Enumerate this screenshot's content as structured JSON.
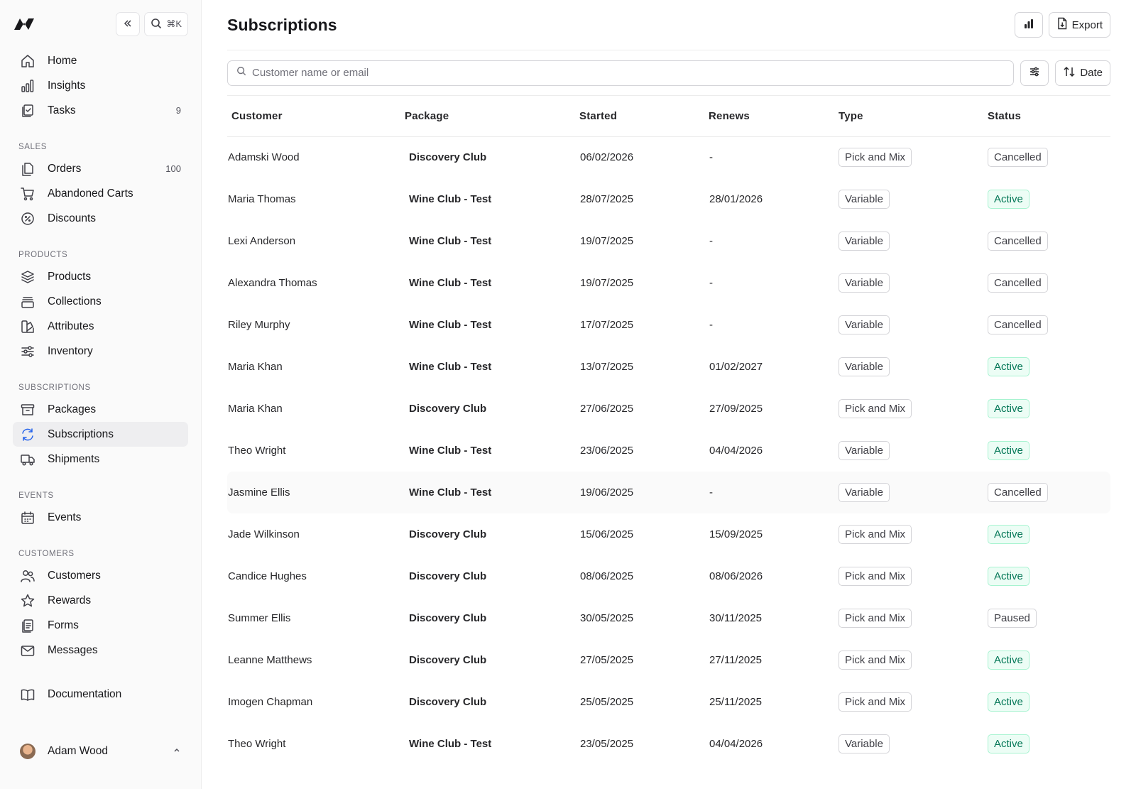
{
  "sidebar": {
    "search_shortcut": "⌘K",
    "main_items": [
      {
        "label": "Home",
        "icon": "home-icon",
        "count": ""
      },
      {
        "label": "Insights",
        "icon": "bar-chart-icon",
        "count": ""
      },
      {
        "label": "Tasks",
        "icon": "clipboard-check-icon",
        "count": "9"
      }
    ],
    "sections": [
      {
        "title": "SALES",
        "items": [
          {
            "label": "Orders",
            "icon": "documents-icon",
            "count": "100"
          },
          {
            "label": "Abandoned Carts",
            "icon": "cart-icon",
            "count": ""
          },
          {
            "label": "Discounts",
            "icon": "discount-icon",
            "count": ""
          }
        ]
      },
      {
        "title": "PRODUCTS",
        "items": [
          {
            "label": "Products",
            "icon": "layers-icon",
            "count": ""
          },
          {
            "label": "Collections",
            "icon": "collection-icon",
            "count": ""
          },
          {
            "label": "Attributes",
            "icon": "attributes-icon",
            "count": ""
          },
          {
            "label": "Inventory",
            "icon": "sliders-icon",
            "count": ""
          }
        ]
      },
      {
        "title": "SUBSCRIPTIONS",
        "items": [
          {
            "label": "Packages",
            "icon": "archive-box-icon",
            "count": ""
          },
          {
            "label": "Subscriptions",
            "icon": "refresh-icon",
            "count": "",
            "active": true
          },
          {
            "label": "Shipments",
            "icon": "truck-icon",
            "count": ""
          }
        ]
      },
      {
        "title": "EVENTS",
        "items": [
          {
            "label": "Events",
            "icon": "calendar-icon",
            "count": ""
          }
        ]
      },
      {
        "title": "CUSTOMERS",
        "items": [
          {
            "label": "Customers",
            "icon": "users-icon",
            "count": ""
          },
          {
            "label": "Rewards",
            "icon": "star-icon",
            "count": ""
          },
          {
            "label": "Forms",
            "icon": "forms-icon",
            "count": ""
          },
          {
            "label": "Messages",
            "icon": "envelope-icon",
            "count": ""
          }
        ]
      }
    ],
    "documentation": "Documentation",
    "user_name": "Adam Wood"
  },
  "header": {
    "title": "Subscriptions",
    "export_label": "Export"
  },
  "toolbar": {
    "search_placeholder": "Customer name or email",
    "sort_label": "Date"
  },
  "table": {
    "columns": [
      "Customer",
      "Package",
      "Started",
      "Renews",
      "Type",
      "Status"
    ],
    "rows": [
      {
        "customer": "Adamski Wood",
        "package": "Discovery Club",
        "started": "06/02/2026",
        "renews": "-",
        "type": "Pick and Mix",
        "status": "Cancelled"
      },
      {
        "customer": "Maria Thomas",
        "package": "Wine Club - Test",
        "started": "28/07/2025",
        "renews": "28/01/2026",
        "type": "Variable",
        "status": "Active"
      },
      {
        "customer": "Lexi Anderson",
        "package": "Wine Club - Test",
        "started": "19/07/2025",
        "renews": "-",
        "type": "Variable",
        "status": "Cancelled"
      },
      {
        "customer": "Alexandra Thomas",
        "package": "Wine Club - Test",
        "started": "19/07/2025",
        "renews": "-",
        "type": "Variable",
        "status": "Cancelled"
      },
      {
        "customer": "Riley Murphy",
        "package": "Wine Club - Test",
        "started": "17/07/2025",
        "renews": "-",
        "type": "Variable",
        "status": "Cancelled"
      },
      {
        "customer": "Maria Khan",
        "package": "Wine Club - Test",
        "started": "13/07/2025",
        "renews": "01/02/2027",
        "type": "Variable",
        "status": "Active"
      },
      {
        "customer": "Maria Khan",
        "package": "Discovery Club",
        "started": "27/06/2025",
        "renews": "27/09/2025",
        "type": "Pick and Mix",
        "status": "Active"
      },
      {
        "customer": "Theo Wright",
        "package": "Wine Club - Test",
        "started": "23/06/2025",
        "renews": "04/04/2026",
        "type": "Variable",
        "status": "Active"
      },
      {
        "customer": "Jasmine Ellis",
        "package": "Wine Club - Test",
        "started": "19/06/2025",
        "renews": "-",
        "type": "Variable",
        "status": "Cancelled",
        "highlighted": true
      },
      {
        "customer": "Jade Wilkinson",
        "package": "Discovery Club",
        "started": "15/06/2025",
        "renews": "15/09/2025",
        "type": "Pick and Mix",
        "status": "Active"
      },
      {
        "customer": "Candice Hughes",
        "package": "Discovery Club",
        "started": "08/06/2025",
        "renews": "08/06/2026",
        "type": "Pick and Mix",
        "status": "Active"
      },
      {
        "customer": "Summer Ellis",
        "package": "Discovery Club",
        "started": "30/05/2025",
        "renews": "30/11/2025",
        "type": "Pick and Mix",
        "status": "Paused"
      },
      {
        "customer": "Leanne Matthews",
        "package": "Discovery Club",
        "started": "27/05/2025",
        "renews": "27/11/2025",
        "type": "Pick and Mix",
        "status": "Active"
      },
      {
        "customer": "Imogen Chapman",
        "package": "Discovery Club",
        "started": "25/05/2025",
        "renews": "25/11/2025",
        "type": "Pick and Mix",
        "status": "Active"
      },
      {
        "customer": "Theo Wright",
        "package": "Wine Club - Test",
        "started": "23/05/2025",
        "renews": "04/04/2026",
        "type": "Variable",
        "status": "Active"
      }
    ]
  },
  "colors": {
    "accent": "#2563eb",
    "active_bg": "#ecfdf5",
    "active_text": "#047857",
    "active_border": "#a7f3d0"
  }
}
